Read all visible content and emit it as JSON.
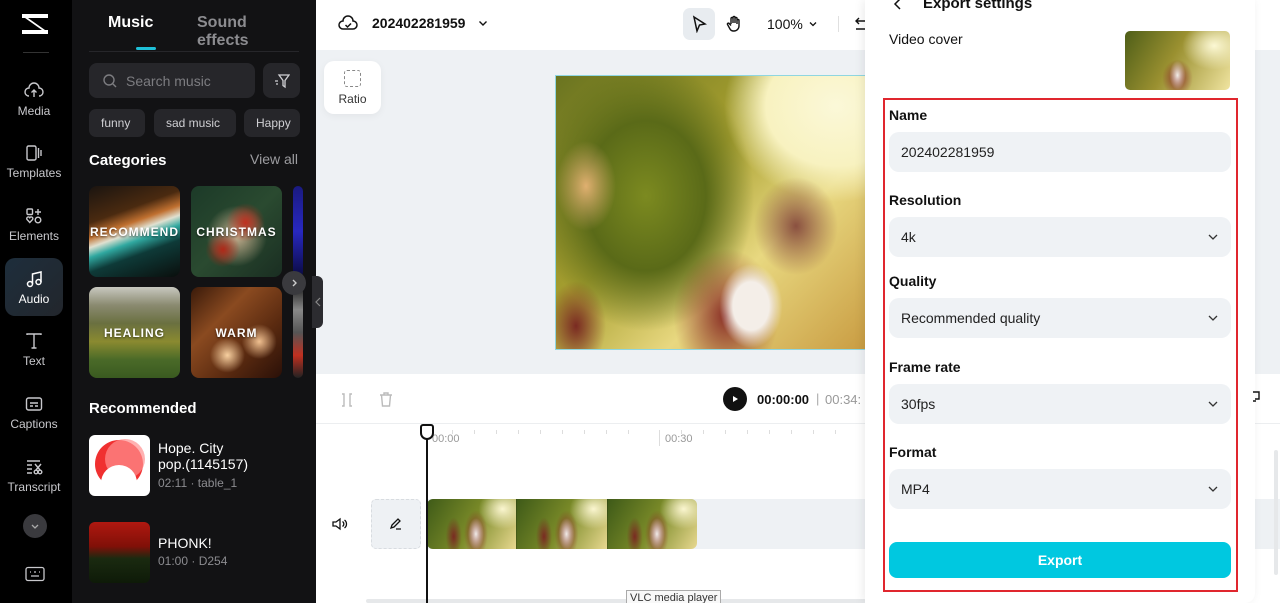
{
  "rail": {
    "items": [
      {
        "label": "Media",
        "icon": "cloud-upload-icon"
      },
      {
        "label": "Templates",
        "icon": "templates-icon"
      },
      {
        "label": "Elements",
        "icon": "elements-icon"
      },
      {
        "label": "Audio",
        "icon": "music-note-icon",
        "active": true
      },
      {
        "label": "Text",
        "icon": "text-icon"
      },
      {
        "label": "Captions",
        "icon": "captions-icon"
      },
      {
        "label": "Transcript",
        "icon": "transcript-icon"
      }
    ]
  },
  "music_panel": {
    "tabs": [
      {
        "label": "Music",
        "active": true
      },
      {
        "label": "Sound effects"
      }
    ],
    "search_placeholder": "Search music",
    "chips": [
      "funny",
      "sad music",
      "Happy"
    ],
    "categories_title": "Categories",
    "view_all": "View all",
    "categories": [
      "RECOMMEND",
      "CHRISTMAS",
      "HEALING",
      "WARM"
    ],
    "recommended_title": "Recommended",
    "recommended": [
      {
        "title": "Hope. City pop.(1145157)",
        "title_line1": "Hope. City",
        "title_line2": "pop.(1145157)",
        "meta": "02:11 · table_1"
      },
      {
        "title": "PHONK!",
        "meta": "01:00 · D254"
      }
    ]
  },
  "topbar": {
    "project_name": "202402281959",
    "zoom": "100%"
  },
  "canvas": {
    "ratio_label": "Ratio"
  },
  "timeline": {
    "current_time": "00:00:00",
    "separator": "|",
    "total_time": "00:34:",
    "ruler": [
      "00:00",
      "00:30"
    ]
  },
  "tooltip": "VLC media player",
  "export_settings": {
    "title": "Export settings",
    "video_cover_label": "Video cover",
    "fields": {
      "name": {
        "label": "Name",
        "value": "202402281959"
      },
      "resolution": {
        "label": "Resolution",
        "value": "4k"
      },
      "quality": {
        "label": "Quality",
        "value": "Recommended quality"
      },
      "frame_rate": {
        "label": "Frame rate",
        "value": "30fps"
      },
      "format": {
        "label": "Format",
        "value": "MP4"
      }
    },
    "export_button": "Export",
    "accent_color": "#00c8e0",
    "highlight_color": "#e0262e"
  }
}
